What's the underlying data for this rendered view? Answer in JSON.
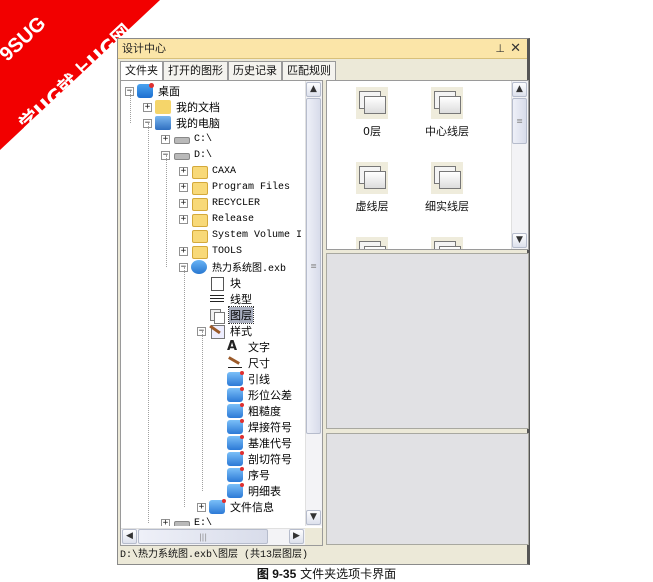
{
  "watermark": {
    "line1": "9SUG",
    "line2": "学UG就上UG网"
  },
  "window": {
    "title": "设计中心",
    "pin_icon": "pin-icon",
    "close_icon": "close-icon"
  },
  "tabs": [
    {
      "label": "文件夹",
      "active": true
    },
    {
      "label": "打开的图形",
      "active": false
    },
    {
      "label": "历史记录",
      "active": false
    },
    {
      "label": "匹配规则",
      "active": false
    }
  ],
  "tree": {
    "nodes": [
      {
        "label": "桌面",
        "icon": "desktop-icon",
        "expander": "-"
      },
      {
        "label": "我的文档",
        "icon": "documents-icon",
        "expander": "+"
      },
      {
        "label": "我的电脑",
        "icon": "computer-icon",
        "expander": "-"
      },
      {
        "label": "C:\\",
        "icon": "drive-icon",
        "expander": "+"
      },
      {
        "label": "D:\\",
        "icon": "drive-icon",
        "expander": "-"
      },
      {
        "label": "CAXA",
        "icon": "folder-icon",
        "expander": "+"
      },
      {
        "label": "Program Files",
        "icon": "folder-icon",
        "expander": "+"
      },
      {
        "label": "RECYCLER",
        "icon": "folder-icon",
        "expander": "+"
      },
      {
        "label": "Release",
        "icon": "folder-icon",
        "expander": "+"
      },
      {
        "label": "System Volume I",
        "icon": "folder-icon",
        "expander": ""
      },
      {
        "label": "TOOLS",
        "icon": "folder-icon",
        "expander": "+"
      },
      {
        "label": "热力系统图.exb",
        "icon": "exb-file-icon",
        "expander": "-"
      },
      {
        "label": "块",
        "icon": "block-icon",
        "expander": ""
      },
      {
        "label": "线型",
        "icon": "linetype-icon",
        "expander": ""
      },
      {
        "label": "图层",
        "icon": "layer-icon",
        "expander": "",
        "selected": true
      },
      {
        "label": "样式",
        "icon": "style-icon",
        "expander": "-"
      },
      {
        "label": "文字",
        "icon": "text-style-icon",
        "expander": ""
      },
      {
        "label": "尺寸",
        "icon": "dimension-style-icon",
        "expander": ""
      },
      {
        "label": "引线",
        "icon": "style-item-icon",
        "expander": ""
      },
      {
        "label": "形位公差",
        "icon": "style-item-icon",
        "expander": ""
      },
      {
        "label": "粗糙度",
        "icon": "style-item-icon",
        "expander": ""
      },
      {
        "label": "焊接符号",
        "icon": "style-item-icon",
        "expander": ""
      },
      {
        "label": "基准代号",
        "icon": "style-item-icon",
        "expander": ""
      },
      {
        "label": "剖切符号",
        "icon": "style-item-icon",
        "expander": ""
      },
      {
        "label": "序号",
        "icon": "style-item-icon",
        "expander": ""
      },
      {
        "label": "明细表",
        "icon": "style-item-icon",
        "expander": ""
      },
      {
        "label": "文件信息",
        "icon": "file-info-icon",
        "expander": "+"
      },
      {
        "label": "E:\\",
        "icon": "drive-icon",
        "expander": "+"
      }
    ],
    "scroll_up": "▲",
    "scroll_down": "▼",
    "scroll_left": "◀",
    "scroll_right": "▶",
    "grip": "≡",
    "hgrip": "|||"
  },
  "layers": [
    {
      "label": "0层"
    },
    {
      "label": "中心线层"
    },
    {
      "label": "虚线层"
    },
    {
      "label": "细实线层"
    },
    {
      "label": ""
    },
    {
      "label": ""
    }
  ],
  "status": "D:\\热力系统图.exb\\图层 (共13层图层)",
  "caption": {
    "figure": "图 9-35",
    "text": "文件夹选项卡界面"
  }
}
